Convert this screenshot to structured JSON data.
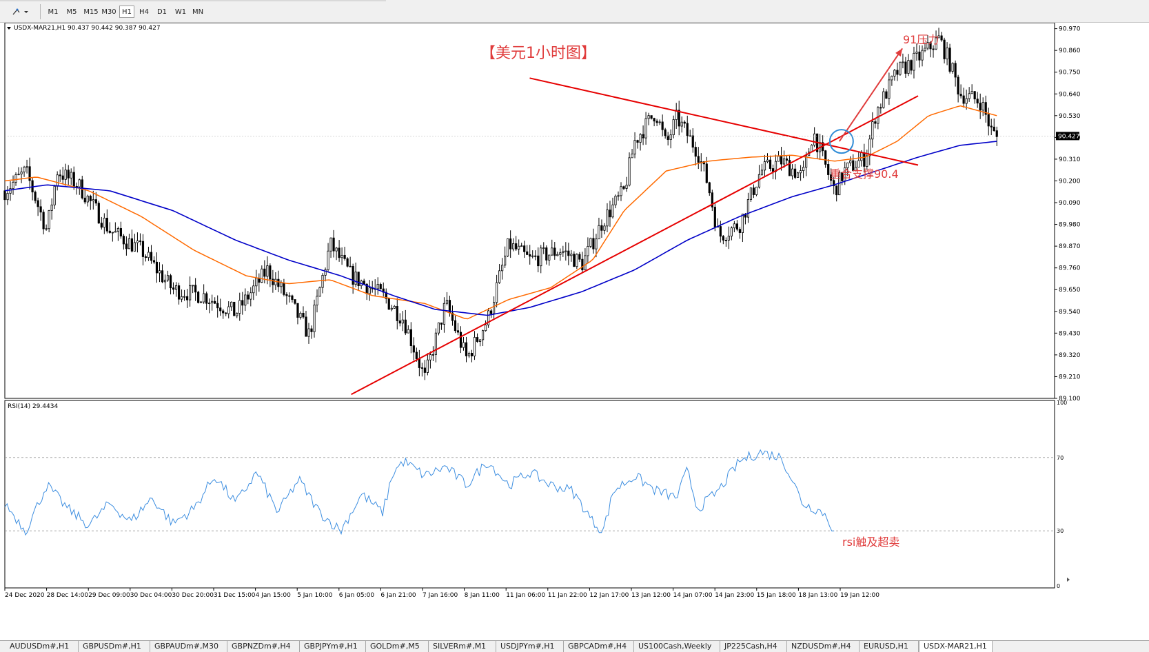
{
  "toolbar": {
    "timeframes": [
      "M1",
      "M5",
      "M15",
      "M30",
      "H1",
      "H4",
      "D1",
      "W1",
      "MN"
    ],
    "active": "H1"
  },
  "chart_data": [
    {
      "type": "candlestick",
      "header": "USDX-MAR21,H1  90.437 90.442 90.387 90.427",
      "title": "【美元1小时图】",
      "price_ticks": [
        "90.970",
        "90.860",
        "90.750",
        "90.640",
        "90.530",
        "90.420",
        "90.310",
        "90.200",
        "90.090",
        "89.980",
        "89.870",
        "89.760",
        "89.650",
        "89.540",
        "89.430",
        "89.320",
        "89.210",
        "89.100"
      ],
      "current_price_label": "90.427",
      "ylim": [
        89.1,
        91.0
      ],
      "x_labels": [
        "24 Dec 2020",
        "28 Dec 14:00",
        "29 Dec 09:00",
        "30 Dec 04:00",
        "30 Dec 20:00",
        "31 Dec 15:00",
        "4 Jan 15:00",
        "5 Jan 10:00",
        "6 Jan 05:00",
        "6 Jan 21:00",
        "7 Jan 16:00",
        "8 Jan 11:00",
        "11 Jan 06:00",
        "11 Jan 22:00",
        "12 Jan 17:00",
        "13 Jan 12:00",
        "14 Jan 07:00",
        "14 Jan 23:00",
        "15 Jan 18:00",
        "18 Jan 13:00",
        "19 Jan 12:00"
      ],
      "price_anchors": [
        {
          "x": 0,
          "p": 90.15
        },
        {
          "x": 0.02,
          "p": 90.25
        },
        {
          "x": 0.04,
          "p": 89.95
        },
        {
          "x": 0.05,
          "p": 90.25
        },
        {
          "x": 0.07,
          "p": 90.18
        },
        {
          "x": 0.1,
          "p": 89.95
        },
        {
          "x": 0.13,
          "p": 89.85
        },
        {
          "x": 0.16,
          "p": 89.65
        },
        {
          "x": 0.19,
          "p": 89.62
        },
        {
          "x": 0.22,
          "p": 89.53
        },
        {
          "x": 0.25,
          "p": 89.75
        },
        {
          "x": 0.27,
          "p": 89.6
        },
        {
          "x": 0.29,
          "p": 89.42
        },
        {
          "x": 0.31,
          "p": 89.88
        },
        {
          "x": 0.33,
          "p": 89.72
        },
        {
          "x": 0.36,
          "p": 89.62
        },
        {
          "x": 0.38,
          "p": 89.5
        },
        {
          "x": 0.4,
          "p": 89.2
        },
        {
          "x": 0.42,
          "p": 89.58
        },
        {
          "x": 0.44,
          "p": 89.3
        },
        {
          "x": 0.46,
          "p": 89.5
        },
        {
          "x": 0.48,
          "p": 89.88
        },
        {
          "x": 0.5,
          "p": 89.8
        },
        {
          "x": 0.53,
          "p": 89.85
        },
        {
          "x": 0.55,
          "p": 89.78
        },
        {
          "x": 0.57,
          "p": 90.0
        },
        {
          "x": 0.59,
          "p": 90.15
        },
        {
          "x": 0.6,
          "p": 90.4
        },
        {
          "x": 0.62,
          "p": 90.55
        },
        {
          "x": 0.63,
          "p": 90.38
        },
        {
          "x": 0.64,
          "p": 90.52
        },
        {
          "x": 0.66,
          "p": 90.35
        },
        {
          "x": 0.67,
          "p": 90.18
        },
        {
          "x": 0.68,
          "p": 89.92
        },
        {
          "x": 0.7,
          "p": 89.98
        },
        {
          "x": 0.72,
          "p": 90.25
        },
        {
          "x": 0.74,
          "p": 90.3
        },
        {
          "x": 0.76,
          "p": 90.22
        },
        {
          "x": 0.77,
          "p": 90.45
        },
        {
          "x": 0.79,
          "p": 90.15
        },
        {
          "x": 0.8,
          "p": 90.25
        },
        {
          "x": 0.82,
          "p": 90.32
        },
        {
          "x": 0.83,
          "p": 90.55
        },
        {
          "x": 0.85,
          "p": 90.75
        },
        {
          "x": 0.87,
          "p": 90.82
        },
        {
          "x": 0.89,
          "p": 90.92
        },
        {
          "x": 0.9,
          "p": 90.8
        },
        {
          "x": 0.91,
          "p": 90.64
        },
        {
          "x": 0.93,
          "p": 90.6
        },
        {
          "x": 0.94,
          "p": 90.45
        },
        {
          "x": 0.945,
          "p": 90.42
        }
      ],
      "ma_orange_anchors": [
        {
          "x": 0,
          "p": 90.2
        },
        {
          "x": 0.03,
          "p": 90.22
        },
        {
          "x": 0.08,
          "p": 90.15
        },
        {
          "x": 0.13,
          "p": 90.02
        },
        {
          "x": 0.18,
          "p": 89.85
        },
        {
          "x": 0.23,
          "p": 89.72
        },
        {
          "x": 0.27,
          "p": 89.68
        },
        {
          "x": 0.31,
          "p": 89.7
        },
        {
          "x": 0.35,
          "p": 89.62
        },
        {
          "x": 0.4,
          "p": 89.58
        },
        {
          "x": 0.44,
          "p": 89.5
        },
        {
          "x": 0.48,
          "p": 89.6
        },
        {
          "x": 0.52,
          "p": 89.66
        },
        {
          "x": 0.56,
          "p": 89.8
        },
        {
          "x": 0.59,
          "p": 90.05
        },
        {
          "x": 0.63,
          "p": 90.25
        },
        {
          "x": 0.67,
          "p": 90.3
        },
        {
          "x": 0.71,
          "p": 90.32
        },
        {
          "x": 0.75,
          "p": 90.33
        },
        {
          "x": 0.79,
          "p": 90.3
        },
        {
          "x": 0.82,
          "p": 90.32
        },
        {
          "x": 0.85,
          "p": 90.4
        },
        {
          "x": 0.88,
          "p": 90.53
        },
        {
          "x": 0.91,
          "p": 90.58
        },
        {
          "x": 0.945,
          "p": 90.53
        }
      ],
      "ma_blue_anchors": [
        {
          "x": 0,
          "p": 90.15
        },
        {
          "x": 0.04,
          "p": 90.18
        },
        {
          "x": 0.1,
          "p": 90.15
        },
        {
          "x": 0.16,
          "p": 90.05
        },
        {
          "x": 0.22,
          "p": 89.9
        },
        {
          "x": 0.27,
          "p": 89.8
        },
        {
          "x": 0.32,
          "p": 89.72
        },
        {
          "x": 0.37,
          "p": 89.62
        },
        {
          "x": 0.41,
          "p": 89.55
        },
        {
          "x": 0.46,
          "p": 89.52
        },
        {
          "x": 0.5,
          "p": 89.56
        },
        {
          "x": 0.55,
          "p": 89.64
        },
        {
          "x": 0.6,
          "p": 89.75
        },
        {
          "x": 0.65,
          "p": 89.9
        },
        {
          "x": 0.7,
          "p": 90.02
        },
        {
          "x": 0.75,
          "p": 90.12
        },
        {
          "x": 0.79,
          "p": 90.18
        },
        {
          "x": 0.83,
          "p": 90.25
        },
        {
          "x": 0.87,
          "p": 90.32
        },
        {
          "x": 0.91,
          "p": 90.38
        },
        {
          "x": 0.945,
          "p": 90.4
        }
      ],
      "trendlines": [
        {
          "name": "support",
          "from": {
            "x": 0.33,
            "p": 89.12
          },
          "to": {
            "x": 0.87,
            "p": 90.63
          }
        },
        {
          "name": "resistance",
          "from": {
            "x": 0.5,
            "p": 90.72
          },
          "to": {
            "x": 0.87,
            "p": 90.28
          }
        }
      ],
      "annotations": {
        "pressure": "91压力",
        "support": "重合支撑90.4"
      }
    },
    {
      "type": "line",
      "header": "RSI(14) 29.4434",
      "y_ticks": [
        "100",
        "70",
        "30",
        "0"
      ],
      "ylim": [
        0,
        100
      ],
      "levels": [
        70,
        30
      ],
      "rsi_anchors": [
        {
          "x": 0,
          "p": 45
        },
        {
          "x": 0.02,
          "p": 30
        },
        {
          "x": 0.04,
          "p": 55
        },
        {
          "x": 0.06,
          "p": 42
        },
        {
          "x": 0.08,
          "p": 33
        },
        {
          "x": 0.1,
          "p": 45
        },
        {
          "x": 0.12,
          "p": 35
        },
        {
          "x": 0.14,
          "p": 48
        },
        {
          "x": 0.16,
          "p": 34
        },
        {
          "x": 0.18,
          "p": 42
        },
        {
          "x": 0.2,
          "p": 60
        },
        {
          "x": 0.22,
          "p": 45
        },
        {
          "x": 0.24,
          "p": 62
        },
        {
          "x": 0.26,
          "p": 40
        },
        {
          "x": 0.28,
          "p": 58
        },
        {
          "x": 0.3,
          "p": 40
        },
        {
          "x": 0.32,
          "p": 30
        },
        {
          "x": 0.34,
          "p": 50
        },
        {
          "x": 0.36,
          "p": 40
        },
        {
          "x": 0.37,
          "p": 62
        },
        {
          "x": 0.38,
          "p": 68
        },
        {
          "x": 0.4,
          "p": 60
        },
        {
          "x": 0.42,
          "p": 65
        },
        {
          "x": 0.44,
          "p": 55
        },
        {
          "x": 0.46,
          "p": 68
        },
        {
          "x": 0.48,
          "p": 55
        },
        {
          "x": 0.5,
          "p": 62
        },
        {
          "x": 0.52,
          "p": 55
        },
        {
          "x": 0.54,
          "p": 52
        },
        {
          "x": 0.55,
          "p": 44
        },
        {
          "x": 0.56,
          "p": 35
        },
        {
          "x": 0.57,
          "p": 30
        },
        {
          "x": 0.58,
          "p": 52
        },
        {
          "x": 0.6,
          "p": 60
        },
        {
          "x": 0.62,
          "p": 52
        },
        {
          "x": 0.64,
          "p": 48
        },
        {
          "x": 0.65,
          "p": 63
        },
        {
          "x": 0.66,
          "p": 42
        },
        {
          "x": 0.68,
          "p": 52
        },
        {
          "x": 0.7,
          "p": 68
        },
        {
          "x": 0.72,
          "p": 73
        },
        {
          "x": 0.74,
          "p": 70
        },
        {
          "x": 0.75,
          "p": 58
        },
        {
          "x": 0.76,
          "p": 45
        },
        {
          "x": 0.78,
          "p": 40
        },
        {
          "x": 0.79,
          "p": 30
        }
      ],
      "annotation": "rsi触及超卖"
    }
  ],
  "tabs": {
    "items": [
      "AUDUSDm#,H1",
      "GBPUSDm#,H1",
      "GBPAUDm#,M30",
      "GBPNZDm#,H4",
      "GBPJPYm#,H1",
      "GOLDm#,M5",
      "SILVERm#,M1",
      "USDJPYm#,H1",
      "GBPCADm#,H4",
      "US100Cash,Weekly",
      "JP225Cash,H4",
      "NZDUSDm#,H4",
      "EURUSD,H1",
      "USDX-MAR21,H1"
    ],
    "active": "USDX-MAR21,H1"
  },
  "colors": {
    "candle": "#000000",
    "ma_orange": "#ff6a00",
    "ma_blue": "#0000c8",
    "trendline": "#e60000",
    "annotation": "#e03c3c",
    "rsi": "#3d8ee0",
    "circle": "#2e8bd6"
  }
}
